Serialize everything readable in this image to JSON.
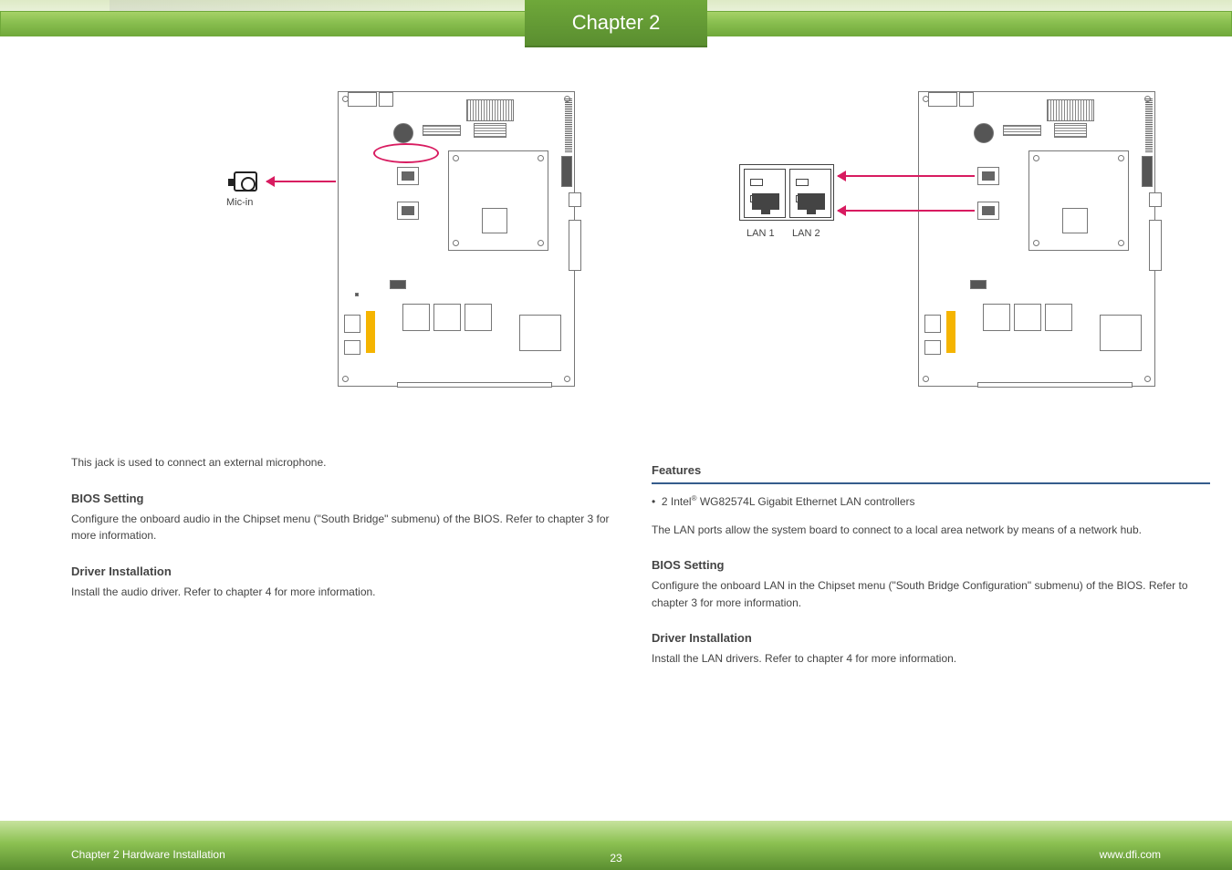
{
  "chapter_tab": "Chapter 2",
  "left_column": {
    "diagram": {
      "port_label": "Mic-in"
    },
    "intro": "This jack is used to connect an external microphone.",
    "bios_title": "BIOS Setting",
    "bios_text": "Configure the onboard audio in the Chipset menu (\"South Bridge\" submenu) of the BIOS. Refer to chapter 3 for more information.",
    "driver_title": "Driver Installation",
    "driver_text": "Install the audio driver. Refer to chapter 4 for more information."
  },
  "right_column": {
    "diagram": {
      "lan1_label": "LAN 1",
      "lan2_label": "LAN 2"
    },
    "features_title": "Features",
    "feature_bullet_prefix": "2 Intel",
    "feature_bullet_suffix": " WG82574L Gigabit Ethernet LAN controllers",
    "feature_reg": "®",
    "intro": "The LAN ports allow the system board to connect to a local area network by means of a network hub.",
    "bios_title": "BIOS Setting",
    "bios_text": "Configure the onboard LAN in the Chipset menu (\"South Bridge Configuration\" submenu) of the BIOS. Refer to chapter 3 for more information.",
    "driver_title": "Driver Installation",
    "driver_text": "Install the LAN drivers. Refer to chapter 4 for more information."
  },
  "footer": {
    "left": "Chapter 2 Hardware Installation",
    "page": "23",
    "right": "www.dfi.com"
  }
}
